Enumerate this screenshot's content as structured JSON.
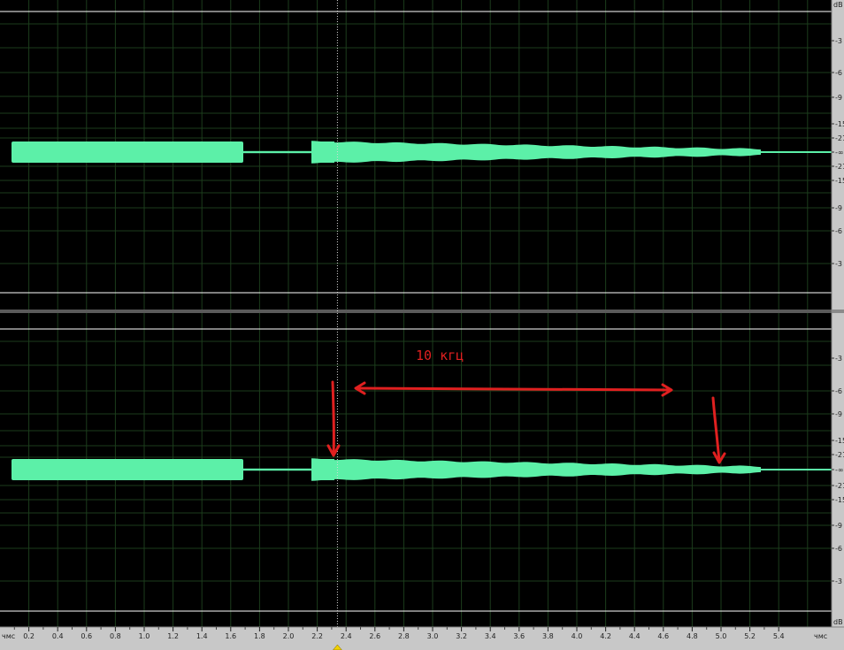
{
  "timeline": {
    "unit_label": "чмс",
    "ticks": [
      "0.2",
      "0.4",
      "0.6",
      "0.8",
      "1.0",
      "1.2",
      "1.4",
      "1.6",
      "1.8",
      "2.0",
      "2.2",
      "2.4",
      "2.6",
      "2.8",
      "3.0",
      "3.2",
      "3.4",
      "3.6",
      "3.8",
      "4.0",
      "4.2",
      "4.4",
      "4.6",
      "4.8",
      "5.0",
      "5.2",
      "5.4"
    ]
  },
  "db_scale": {
    "unit": "dB",
    "upper_labels": [
      "-3",
      "-6",
      "-9",
      "-15",
      "-21",
      "-∞",
      "-21",
      "-15",
      "-9",
      "-6",
      "-3"
    ],
    "lower_labels": [
      "-3",
      "-6",
      "-9",
      "-15",
      "-21",
      "-∞",
      "-21",
      "-15",
      "-9",
      "-6",
      "-3"
    ]
  },
  "annotation": {
    "label": "10 кгц"
  },
  "colors": {
    "background": "#000000",
    "grid": "#1c3d1c",
    "waveform": "#5cf0a8",
    "boundary": "#ffffff",
    "annotation": "#e02020",
    "panel": "#c8c8c8"
  },
  "playhead_time": 2.34
}
